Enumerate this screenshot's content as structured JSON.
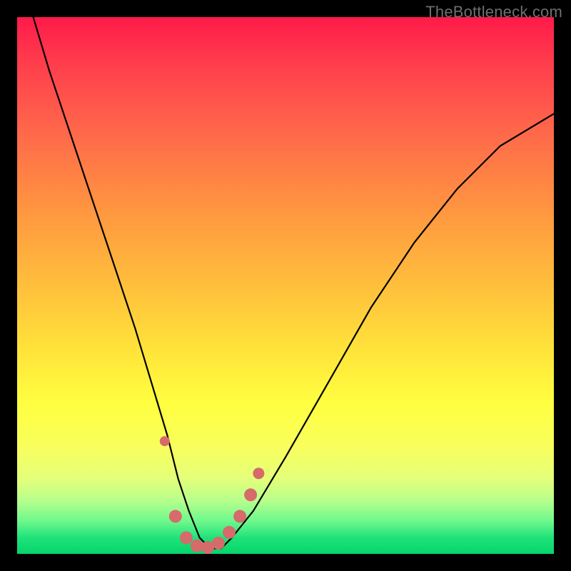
{
  "watermark": "TheBottleneck.com",
  "chart_data": {
    "type": "line",
    "title": "",
    "xlabel": "",
    "ylabel": "",
    "xlim": [
      0,
      100
    ],
    "ylim": [
      0,
      100
    ],
    "series": [
      {
        "name": "bottleneck-curve",
        "x": [
          3,
          6,
          10,
          14,
          18,
          22,
          25,
          28,
          30,
          32,
          34,
          36,
          38,
          40,
          44,
          50,
          58,
          66,
          74,
          82,
          90,
          100
        ],
        "values": [
          100,
          90,
          78,
          66,
          54,
          42,
          32,
          22,
          14,
          8,
          3,
          1,
          1,
          3,
          8,
          18,
          32,
          46,
          58,
          68,
          76,
          82
        ]
      }
    ],
    "markers": [
      {
        "x": 27.5,
        "y": 21,
        "r": 7
      },
      {
        "x": 29.5,
        "y": 7,
        "r": 9
      },
      {
        "x": 31.5,
        "y": 3,
        "r": 9
      },
      {
        "x": 33.5,
        "y": 1.5,
        "r": 9
      },
      {
        "x": 35.5,
        "y": 1.2,
        "r": 9
      },
      {
        "x": 37.5,
        "y": 2,
        "r": 9
      },
      {
        "x": 39.5,
        "y": 4,
        "r": 9
      },
      {
        "x": 41.5,
        "y": 7,
        "r": 9
      },
      {
        "x": 43.5,
        "y": 11,
        "r": 9
      },
      {
        "x": 45.0,
        "y": 15,
        "r": 8
      }
    ],
    "marker_color": "#d76a6a"
  }
}
